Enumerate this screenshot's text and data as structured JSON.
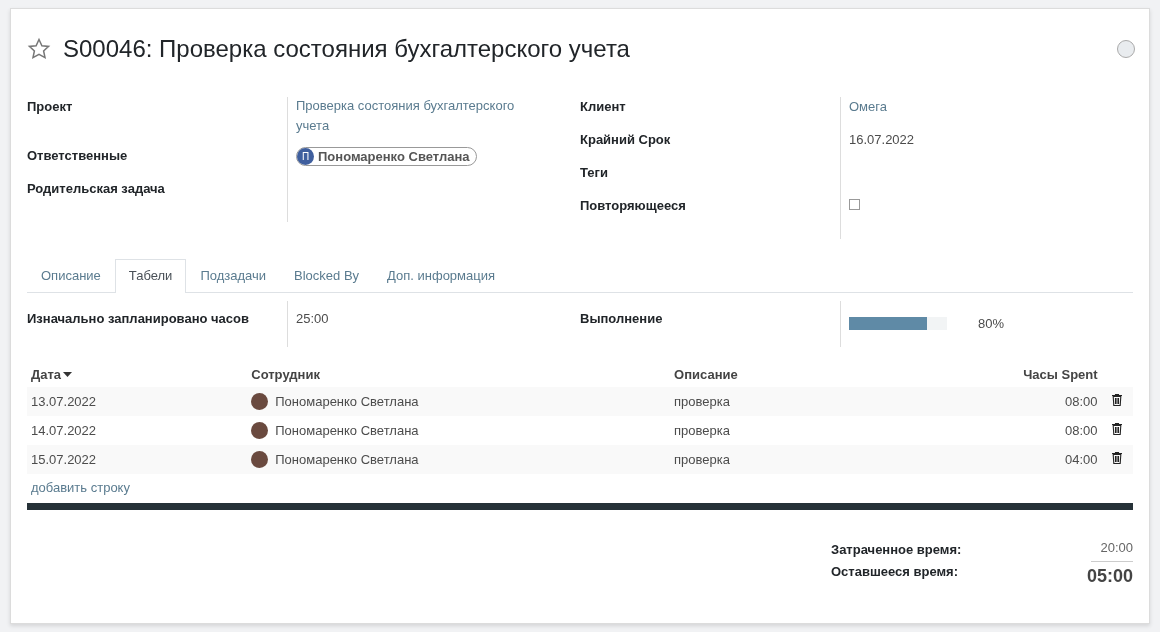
{
  "title": "S00046: Проверка состояния бухгалтерского учета",
  "starred": false,
  "fields_left": [
    {
      "label": "Проект",
      "kind": "link",
      "value": "Проверка состояния бухгалтерского учета"
    },
    {
      "label": "Ответственные",
      "kind": "tag",
      "value": "Пономаренко Светлана",
      "initial": "П"
    },
    {
      "label": "Родительская задача",
      "kind": "empty"
    }
  ],
  "fields_right": [
    {
      "label": "Клиент",
      "kind": "link",
      "value": "Омега"
    },
    {
      "label": "Крайний Срок",
      "kind": "text",
      "value": "16.07.2022"
    },
    {
      "label": "Теги",
      "kind": "empty"
    },
    {
      "label": "Повторяющееся",
      "kind": "checkbox",
      "checked": false
    }
  ],
  "tabs": [
    {
      "label": "Описание",
      "selected": false
    },
    {
      "label": "Табели",
      "selected": true
    },
    {
      "label": "Подзадачи",
      "selected": false
    },
    {
      "label": "Blocked By",
      "selected": false
    },
    {
      "label": "Доп. информация",
      "selected": false
    }
  ],
  "planned": {
    "label": "Изначально запланировано часов",
    "value": "25:00"
  },
  "progress": {
    "label": "Выполнение",
    "level": 0.8,
    "reading": "80%"
  },
  "table": {
    "columns": [
      "Дата",
      "Сотрудник",
      "Описание",
      "Часы Spent"
    ],
    "rows": [
      {
        "date": "13.07.2022",
        "employee": "Пономаренко Светлана",
        "description": "проверка",
        "hours": "08:00"
      },
      {
        "date": "14.07.2022",
        "employee": "Пономаренко Светлана",
        "description": "проверка",
        "hours": "08:00"
      },
      {
        "date": "15.07.2022",
        "employee": "Пономаренко Светлана",
        "description": "проверка",
        "hours": "04:00"
      }
    ],
    "add_line": "добавить строку"
  },
  "totals": {
    "spent_label": "Затраченное время:",
    "spent": "20:00",
    "remaining_label": "Оставшееся время:",
    "remaining": "05:00"
  }
}
